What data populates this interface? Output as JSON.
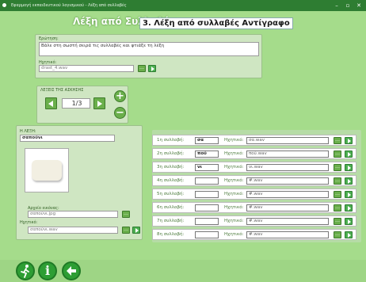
{
  "window": {
    "title": "Εφαρμογή εκπαιδευτικού λογισμικού - Λέξη από συλλαβές"
  },
  "header": {
    "label": "Λέξη από Συλλαβές:",
    "exercise_title": "3. Λέξη από συλλαβές Αντίγραφο"
  },
  "question": {
    "label": "Ερώτηση:",
    "text": "Βάλε στη σωστή σειρά τις συλλαβές και φτιάξε τη λέξη",
    "audio_label": "Ηχητικό:",
    "audio_file": "drast_4.wav"
  },
  "words_nav": {
    "label": "ΛΕΞΕΙΣ ΤΗΣ ΑΣΚΗΣΗΣ",
    "counter": "1/3",
    "add_symbol": "+",
    "remove_symbol": "−"
  },
  "word": {
    "label": "Η ΛΕΞΗ:",
    "value": "σαπούνι",
    "image_label": "Αρχείο εικόνας:",
    "image_file": "σαπούνι.jpg",
    "audio_label": "Ηχητικό:",
    "audio_file": "σαπούνι.wav"
  },
  "syllables": [
    {
      "label": "1η συλλαβή:",
      "value": "σα",
      "audio_label": "Ηχητικό:",
      "audio": "σα.wav"
    },
    {
      "label": "2η συλλαβή:",
      "value": "πού",
      "audio_label": "Ηχητικό:",
      "audio": "πού.wav"
    },
    {
      "label": "3η συλλαβή:",
      "value": "νι",
      "audio_label": "Ηχητικό:",
      "audio": "νι.wav"
    },
    {
      "label": "4η συλλαβή:",
      "value": "",
      "audio_label": "Ηχητικό:",
      "audio": "#.wav"
    },
    {
      "label": "5η συλλαβή:",
      "value": "",
      "audio_label": "Ηχητικό:",
      "audio": "#.wav"
    },
    {
      "label": "6η συλλαβή:",
      "value": "",
      "audio_label": "Ηχητικό:",
      "audio": "#.wav"
    },
    {
      "label": "7η συλλαβή:",
      "value": "",
      "audio_label": "Ηχητικό:",
      "audio": "#.wav"
    },
    {
      "label": "8η συλλαβή:",
      "value": "",
      "audio_label": "Ηχητικό:",
      "audio": "#.wav"
    }
  ],
  "icons": {
    "browse": "…",
    "play": "play-icon",
    "exit": "running-man-icon",
    "info": "info-icon",
    "back": "back-arrow-icon"
  },
  "colors": {
    "background": "#a5dc8b",
    "panel": "#cfe6c2",
    "accent": "#2e9e34",
    "titlebar": "#2e7d32"
  }
}
